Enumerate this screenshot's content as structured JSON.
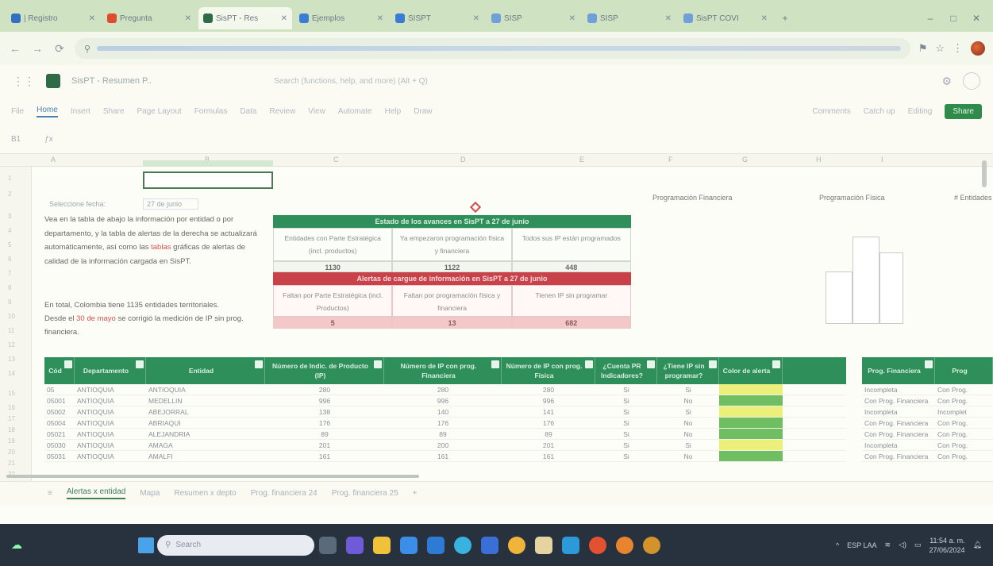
{
  "browser": {
    "tabs": [
      {
        "label": "| Registro",
        "color": "#2f6fc4",
        "active": false
      },
      {
        "label": "Pregunta",
        "color": "#e04b2e",
        "active": false
      },
      {
        "label": "SisPT - Res",
        "color": "#2e6b46",
        "active": true
      },
      {
        "label": "Ejemplos",
        "color": "#3a7bd5",
        "active": false
      },
      {
        "label": "SISPT",
        "color": "#3a7bd5",
        "active": false
      },
      {
        "label": "SISP",
        "color": "#6fa0d8",
        "active": false
      },
      {
        "label": "SISP",
        "color": "#6fa0d8",
        "active": false
      },
      {
        "label": "SisPT COVI",
        "color": "#6fa0d8",
        "active": false
      }
    ],
    "win_min": "–",
    "win_max": "□",
    "win_close": "✕"
  },
  "excel": {
    "title": "SisPT - Resumen P..",
    "search_placeholder": "Search (functions, help, and more) (Alt + Q)",
    "ribbon_tabs": [
      "File",
      "Home",
      "Insert",
      "Share",
      "Page Layout",
      "Formulas",
      "Data",
      "Review",
      "View",
      "Automate",
      "Help",
      "Draw"
    ],
    "ribbon_right": [
      "Comments",
      "Catch up",
      "Editing"
    ],
    "share_label": "Share",
    "cell_ref": "B1"
  },
  "sheet": {
    "filter_label": "Seleccione fecha:",
    "filter_value": "27 de junio",
    "intro": "Vea en la tabla de abajo la información por entidad o por departamento, y la tabla de alertas de la derecha se actualizará automáticamente, así como las",
    "intro_hl": "tablas",
    "intro_end": "gráficas de alertas de calidad de la información cargada en SisPT.",
    "note1": "En total, Colombia tiene 1135 entidades territoriales.",
    "note2_pre": "Desde el",
    "note2_hl": "30 de mayo",
    "note2_post": "se corrigió la medición de IP sin prog. financiera.",
    "top_labels": [
      "Programación Financiera",
      "Programación Física",
      "# Entidades"
    ],
    "summary": {
      "title": "Estado de los avances en SisPT a 27 de junio",
      "headers": [
        "Entidades con Parte Estratégica (incl. productos)",
        "Ya empezaron programación física y financiera",
        "Todos sus IP están programados"
      ],
      "values": [
        "1130",
        "1122",
        "448"
      ],
      "alert_title": "Alertas de cargue de información en SisPT a 27 de junio",
      "alert_headers": [
        "Faltan por Parte Estratégica (incl. Productos)",
        "Faltan por programación física y financiera",
        "Tienen IP sin programar"
      ],
      "alert_values": [
        "5",
        "13",
        "682"
      ]
    },
    "table": {
      "headers": [
        "Cód",
        "Departamento",
        "Entidad",
        "Número de Indic. de Producto (IP)",
        "Número de IP con prog. Financiera",
        "Número de IP con prog. Física",
        "¿Cuenta PR Indicadores?",
        "¿Tiene IP sin programar?",
        "Color de alerta"
      ],
      "rows": [
        [
          "05",
          "ANTIOQUIA",
          "ANTIOQUIA",
          "280",
          "280",
          "280",
          "Si",
          "Si",
          "#ecef7a"
        ],
        [
          "05001",
          "ANTIOQUIA",
          "MEDELLIN",
          "996",
          "996",
          "996",
          "Si",
          "No",
          "#6fbf62"
        ],
        [
          "05002",
          "ANTIOQUIA",
          "ABEJORRAL",
          "138",
          "140",
          "141",
          "Si",
          "Si",
          "#ecef7a"
        ],
        [
          "05004",
          "ANTIOQUIA",
          "ABRIAQUI",
          "176",
          "176",
          "176",
          "Si",
          "No",
          "#6fbf62"
        ],
        [
          "05021",
          "ANTIOQUIA",
          "ALEJANDRIA",
          "89",
          "89",
          "89",
          "Si",
          "No",
          "#6fbf62"
        ],
        [
          "05030",
          "ANTIOQUIA",
          "AMAGA",
          "201",
          "200",
          "201",
          "Si",
          "Si",
          "#ecef7a"
        ],
        [
          "05031",
          "ANTIOQUIA",
          "AMALFI",
          "161",
          "161",
          "161",
          "Si",
          "No",
          "#6fbf62"
        ]
      ]
    },
    "table2": {
      "headers": [
        "Prog. Financiera",
        "Prog"
      ],
      "rows": [
        [
          "Incompleta",
          "Con Prog."
        ],
        [
          "Con Prog. Financiera",
          "Con Prog."
        ],
        [
          "Incompleta",
          "Incomplet"
        ],
        [
          "Con Prog. Financiera",
          "Con Prog."
        ],
        [
          "Con Prog. Financiera",
          "Con Prog."
        ],
        [
          "Incompleta",
          "Con Prog."
        ],
        [
          "Con Prog. Financiera",
          "Con Prog."
        ]
      ]
    }
  },
  "sheet_tabs": [
    "Alertas x entidad",
    "Mapa",
    "Resumen x depto",
    "Prog. financiera 24",
    "Prog. financiera 25"
  ],
  "sheet_tab_add": "+",
  "taskbar": {
    "search_placeholder": "Search",
    "time": "11:54 a. m.",
    "date": "27/06/2024",
    "lang": "ESP LAA"
  },
  "colors": {
    "header_green": "#2f8f5a",
    "alert_red": "#c9424a"
  }
}
